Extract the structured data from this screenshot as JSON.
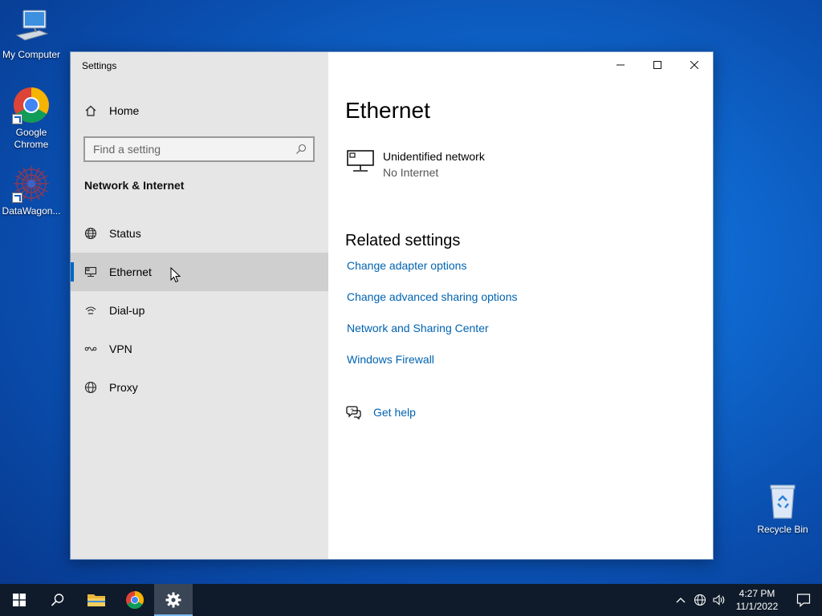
{
  "desktop": {
    "icons": [
      {
        "label": "My Computer"
      },
      {
        "label": "Google Chrome"
      },
      {
        "label": "DataWagon..."
      },
      {
        "label": "Recycle Bin"
      }
    ]
  },
  "window": {
    "title": "Settings",
    "caption": {
      "minimize": "minimize",
      "maximize": "maximize",
      "close": "close"
    }
  },
  "sidebar": {
    "home_label": "Home",
    "search_placeholder": "Find a setting",
    "section_title": "Network & Internet",
    "items": [
      {
        "label": "Status",
        "icon": "globe-status-icon"
      },
      {
        "label": "Ethernet",
        "icon": "ethernet-icon",
        "active": true
      },
      {
        "label": "Dial-up",
        "icon": "dialup-icon"
      },
      {
        "label": "VPN",
        "icon": "vpn-icon"
      },
      {
        "label": "Proxy",
        "icon": "globe-icon"
      }
    ]
  },
  "main": {
    "title": "Ethernet",
    "network": {
      "name": "Unidentified network",
      "status": "No Internet"
    },
    "related_title": "Related settings",
    "links": [
      "Change adapter options",
      "Change advanced sharing options",
      "Network and Sharing Center",
      "Windows Firewall"
    ],
    "help_label": "Get help"
  },
  "taskbar": {
    "time": "4:27 PM",
    "date": "11/1/2022"
  },
  "colors": {
    "accent": "#0067c0",
    "link": "#0063b1",
    "sidebar_bg": "#e6e6e6",
    "taskbar_bg": "#0f1b2a"
  }
}
